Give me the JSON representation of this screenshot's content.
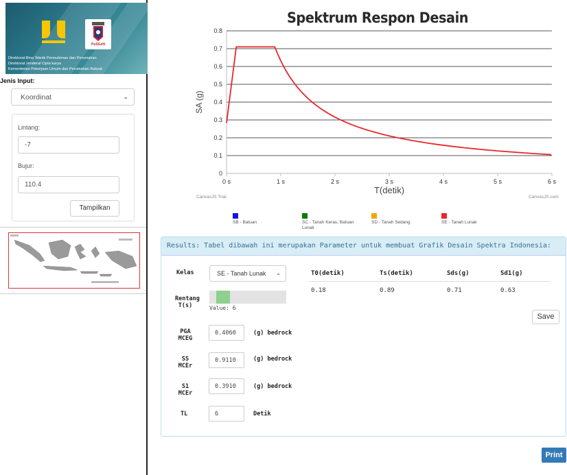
{
  "banner": {
    "line1": "Direktorat Bina Teknik Permukiman dan Perumahan",
    "line2": "Direktorat Jenderal Cipta karya",
    "line3": "Kementerian Pekerjaan Umum dan Perumahan Rakyat",
    "pusgen_logo_text": "PuSGeN"
  },
  "sidebar": {
    "jenis_input_label": "Jenis Input:",
    "jenis_input_value": "Koordinat",
    "lintang_label": "Lintang:",
    "lintang_value": "-7",
    "bujur_label": "Bujur:",
    "bujur_value": "110.4",
    "tampilkan_label": "Tampilkan"
  },
  "chart_data": {
    "type": "line",
    "title": "Spektrum Respon Desain",
    "xlabel": "T(detik)",
    "ylabel": "SA (g)",
    "xlim": [
      0,
      6
    ],
    "ylim": [
      0,
      0.8
    ],
    "x_ticks": [
      "0 s",
      "1 s",
      "2 s",
      "3 s",
      "4 s",
      "5 s",
      "6 s"
    ],
    "y_ticks": [
      "0",
      "0.1",
      "0.2",
      "0.3",
      "0.4",
      "0.5",
      "0.6",
      "0.7",
      "0.8"
    ],
    "grid": true,
    "series": [
      {
        "name": "SE - Tanah Lunak",
        "color": "#e8262b",
        "points": [
          [
            0,
            0.284
          ],
          [
            0.18,
            0.71
          ],
          [
            0.89,
            0.71
          ],
          [
            1.0,
            0.63
          ],
          [
            1.25,
            0.504
          ],
          [
            1.5,
            0.42
          ],
          [
            1.75,
            0.36
          ],
          [
            2.0,
            0.315
          ],
          [
            2.5,
            0.252
          ],
          [
            3.0,
            0.21
          ],
          [
            3.5,
            0.18
          ],
          [
            4.0,
            0.1575
          ],
          [
            4.5,
            0.14
          ],
          [
            5.0,
            0.126
          ],
          [
            5.5,
            0.1145
          ],
          [
            6.0,
            0.105
          ]
        ]
      }
    ],
    "legend": [
      {
        "label": "SB - Batuan",
        "color": "#1515e0"
      },
      {
        "label": "SC - Tanah Keras, Batuan Lunak",
        "color": "#0a7a0a"
      },
      {
        "label": "SD - Tanah Sedang",
        "color": "#f5a300"
      },
      {
        "label": "SE - Tanah Lunak",
        "color": "#e8262b"
      }
    ],
    "legend_placement": "bottom"
  },
  "credits": {
    "left": "CanvasJS Trial",
    "right": "CanvasJS.com"
  },
  "results": {
    "header": "Results: Tabel dibawah ini merupakan Parameter untuk membuat Grafik Desain Spektra Indonesia:",
    "kelas_label": "Kelas",
    "kelas_value": "SE - Tanah Lunak",
    "rentang_label_1": "Rentang",
    "rentang_label_2": "T(s)",
    "slider_value_text": "Value: 6",
    "slider_fraction": 0.15,
    "pga_label_1": "PGA",
    "pga_label_2": "MCEG",
    "pga_value": "0.4060",
    "pga_unit": "(g) bedrock",
    "ss_label_1": "SS",
    "ss_label_2": "MCEr",
    "ss_value": "0.9110",
    "ss_unit": "(g) bedrock",
    "s1_label_1": "S1",
    "s1_label_2": "MCEr",
    "s1_value": "0.3910",
    "s1_unit": "(g) bedrock",
    "tl_label": "TL",
    "tl_value": "6",
    "tl_unit": "Detik",
    "table_headers": [
      "T0(detik)",
      "Ts(detik)",
      "Sds(g)",
      "Sd1(g)"
    ],
    "table_values": [
      "0.18",
      "0.89",
      "0.71",
      "0.63"
    ],
    "save_label": "Save"
  },
  "print_label": "Print",
  "colors": {
    "accent": "#337ab7",
    "panel_header_bg": "#d9edf7",
    "series": "#e8262b"
  }
}
